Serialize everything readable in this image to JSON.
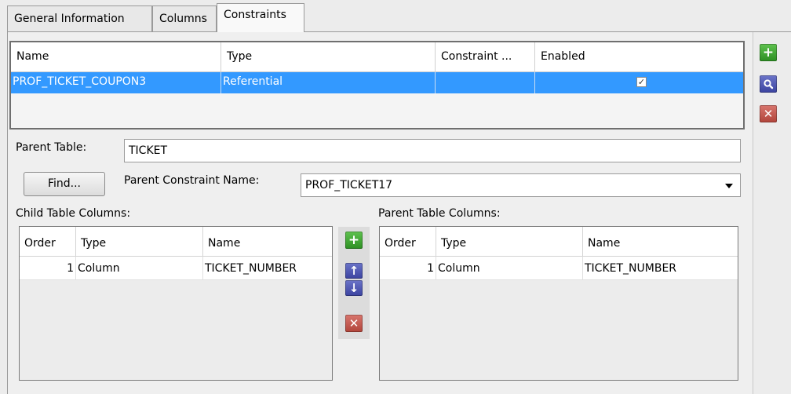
{
  "tabs": [
    "General Information",
    "Columns",
    "Constraints"
  ],
  "constraints_table": {
    "headers": [
      "Name",
      "Type",
      "Constraint ...",
      "Enabled"
    ],
    "rows": [
      {
        "name": "PROF_TICKET_COUPON3",
        "type": "Referential",
        "constraint": "",
        "enabled": "✓"
      }
    ]
  },
  "side_buttons": {
    "add": "+",
    "edit": "⚲",
    "delete": "✕"
  },
  "form": {
    "parent_table_label": "Parent Table:",
    "parent_table_value": "TICKET",
    "find_button": "Find...",
    "parent_constraint_label": "Parent Constraint Name:",
    "parent_constraint_value": "PROF_TICKET17",
    "child_columns_label": "Child Table Columns:",
    "parent_columns_label": "Parent Table Columns:"
  },
  "child_table": {
    "headers": [
      "Order",
      "Type",
      "Name"
    ],
    "rows": [
      {
        "order": "1",
        "type": "Column",
        "name": "TICKET_NUMBER"
      }
    ]
  },
  "parent_columns_table": {
    "headers": [
      "Order",
      "Type",
      "Name"
    ],
    "rows": [
      {
        "order": "1",
        "type": "Column",
        "name": "TICKET_NUMBER"
      }
    ]
  },
  "mid_buttons": {
    "add": "+",
    "up": "↑",
    "down": "↓",
    "delete": "✕"
  }
}
